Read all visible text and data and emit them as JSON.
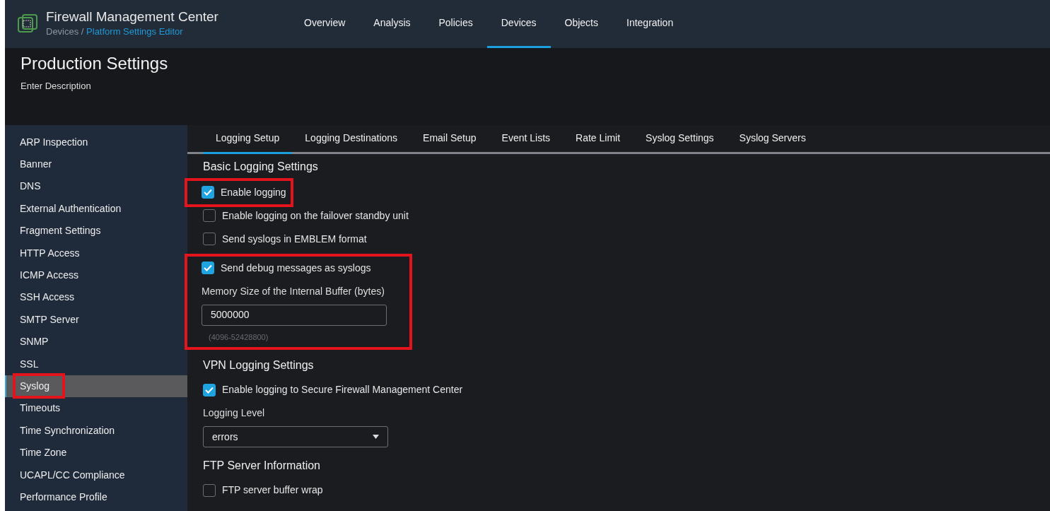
{
  "header": {
    "product": "Firewall Management Center",
    "breadcrumb": {
      "parent": "Devices / ",
      "current": "Platform Settings Editor"
    },
    "nav": [
      {
        "label": "Overview",
        "selected": false
      },
      {
        "label": "Analysis",
        "selected": false
      },
      {
        "label": "Policies",
        "selected": false
      },
      {
        "label": "Devices",
        "selected": true
      },
      {
        "label": "Objects",
        "selected": false
      },
      {
        "label": "Integration",
        "selected": false
      }
    ]
  },
  "page": {
    "title": "Production Settings",
    "description": "Enter Description"
  },
  "sidebar": {
    "items": [
      {
        "label": "ARP Inspection",
        "selected": false,
        "highlighted": false
      },
      {
        "label": "Banner",
        "selected": false,
        "highlighted": false
      },
      {
        "label": "DNS",
        "selected": false,
        "highlighted": false
      },
      {
        "label": "External Authentication",
        "selected": false,
        "highlighted": false
      },
      {
        "label": "Fragment Settings",
        "selected": false,
        "highlighted": false
      },
      {
        "label": "HTTP Access",
        "selected": false,
        "highlighted": false
      },
      {
        "label": "ICMP Access",
        "selected": false,
        "highlighted": false
      },
      {
        "label": "SSH Access",
        "selected": false,
        "highlighted": false
      },
      {
        "label": "SMTP Server",
        "selected": false,
        "highlighted": false
      },
      {
        "label": "SNMP",
        "selected": false,
        "highlighted": false
      },
      {
        "label": "SSL",
        "selected": false,
        "highlighted": false
      },
      {
        "label": "Syslog",
        "selected": true,
        "highlighted": true
      },
      {
        "label": "Timeouts",
        "selected": false,
        "highlighted": false
      },
      {
        "label": "Time Synchronization",
        "selected": false,
        "highlighted": false
      },
      {
        "label": "Time Zone",
        "selected": false,
        "highlighted": false
      },
      {
        "label": "UCAPL/CC Compliance",
        "selected": false,
        "highlighted": false
      },
      {
        "label": "Performance Profile",
        "selected": false,
        "highlighted": false
      }
    ]
  },
  "tabs": [
    {
      "label": "Logging Setup",
      "selected": true
    },
    {
      "label": "Logging Destinations",
      "selected": false
    },
    {
      "label": "Email Setup",
      "selected": false
    },
    {
      "label": "Event Lists",
      "selected": false
    },
    {
      "label": "Rate Limit",
      "selected": false
    },
    {
      "label": "Syslog Settings",
      "selected": false
    },
    {
      "label": "Syslog Servers",
      "selected": false
    }
  ],
  "sections": [
    {
      "title": "Basic Logging Settings",
      "items": [
        {
          "kind": "checkbox",
          "label": "Enable logging",
          "checked": true,
          "highlighted": true
        },
        {
          "kind": "checkbox",
          "label": "Enable logging on the failover standby unit",
          "checked": false,
          "highlighted": false
        },
        {
          "kind": "checkbox",
          "label": "Send syslogs in EMBLEM format",
          "checked": false,
          "highlighted": false
        },
        {
          "kind": "group",
          "highlighted": true,
          "items": [
            {
              "kind": "checkbox",
              "label": "Send debug messages as syslogs",
              "checked": true,
              "highlighted": false
            },
            {
              "kind": "number",
              "label": "Memory Size of the Internal Buffer (bytes)",
              "value": "5000000",
              "hint": "(4096-52428800)"
            }
          ]
        }
      ]
    },
    {
      "title": "VPN Logging Settings",
      "items": [
        {
          "kind": "checkbox",
          "label": "Enable logging to Secure Firewall Management Center",
          "checked": true,
          "highlighted": false
        },
        {
          "kind": "select",
          "label": "Logging Level",
          "value": "errors"
        }
      ]
    },
    {
      "title": "FTP Server Information",
      "items": [
        {
          "kind": "checkbox",
          "label": "FTP server buffer wrap",
          "checked": false,
          "highlighted": false
        }
      ]
    }
  ]
}
